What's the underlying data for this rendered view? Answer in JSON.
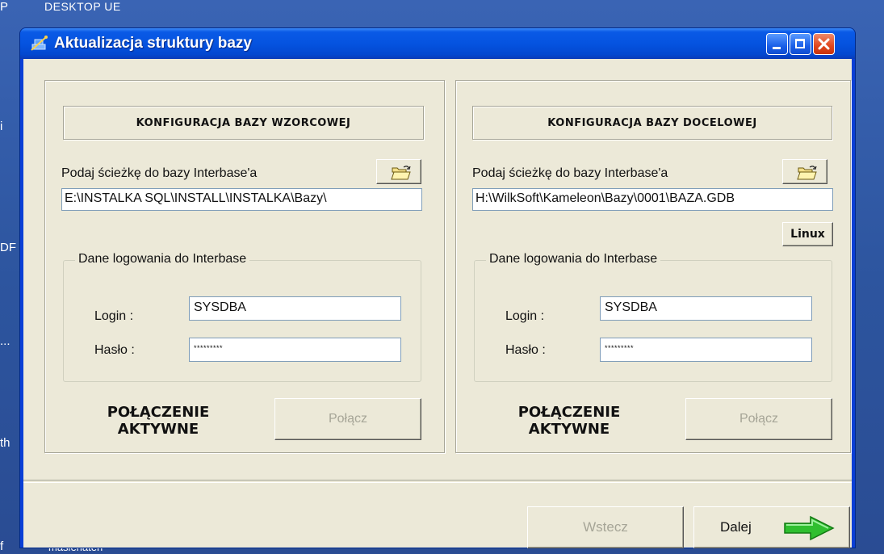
{
  "desktop": {
    "title": "DESKTOP UE",
    "left_marks": [
      "P",
      "i",
      "DF",
      "...",
      "th",
      "f"
    ],
    "bottom_text": "masienaten"
  },
  "window": {
    "title": "Aktualizacja struktury bazy",
    "buttons": [
      "minimize-icon",
      "maximize-icon",
      "close-icon"
    ]
  },
  "left_panel": {
    "heading": "KONFIGURACJA BAZY WZORCOWEJ",
    "path_label": "Podaj ścieżkę do bazy Interbase'a",
    "path_value": "E:\\INSTALKA SQL\\INSTALL\\INSTALKA\\Bazy\\",
    "group_label": "Dane logowania do Interbase",
    "login_label": "Login :",
    "login_value": "SYSDBA",
    "password_label": "Hasło :",
    "password_value": "*********",
    "status": "POŁĄCZENIE AKTYWNE",
    "connect_label": "Połącz"
  },
  "right_panel": {
    "heading": "KONFIGURACJA BAZY DOCELOWEJ",
    "path_label": "Podaj ścieżkę do bazy Interbase'a",
    "path_value": "H:\\WilkSoft\\Kameleon\\Bazy\\0001\\BAZA.GDB",
    "linux_label": "Linux",
    "group_label": "Dane logowania do Interbase",
    "login_label": "Login :",
    "login_value": "SYSDBA",
    "password_label": "Hasło :",
    "password_value": "*********",
    "status": "POŁĄCZENIE AKTYWNE",
    "connect_label": "Połącz"
  },
  "footer": {
    "back_label": "Wstecz",
    "next_label": "Dalej"
  },
  "colors": {
    "titlebar": "#0553e0",
    "window_face": "#ece9d8",
    "disabled_text": "#a6a597",
    "arrow_green": "#2fbf2f"
  }
}
